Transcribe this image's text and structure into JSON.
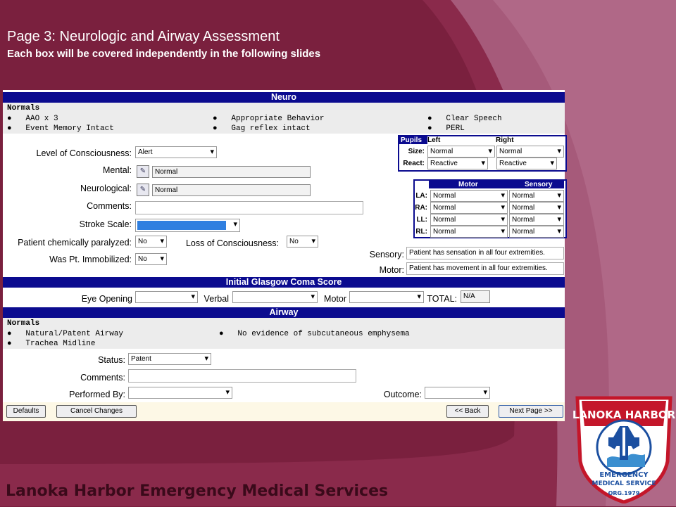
{
  "slide": {
    "title": "Page 3: Neurologic and Airway Assessment",
    "subtitle": "Each box will be covered independently in the following slides",
    "footer": "Lanoka Harbor Emergency Medical Services"
  },
  "colors": {
    "band": "#0b0b8f",
    "bg": "#7a1f3d",
    "highlight": "#2f7fe0"
  },
  "neuro": {
    "title": "Neuro",
    "normals_label": "Normals",
    "normals": [
      "AAO x 3",
      "Appropriate Behavior",
      "Clear Speech",
      "Event Memory Intact",
      "Gag reflex intact",
      "PERL"
    ],
    "loc_label": "Level of Consciousness:",
    "loc_value": "Alert",
    "mental_label": "Mental:",
    "mental_value": "Normal",
    "neuro_label": "Neurological:",
    "neuro_value": "Normal",
    "comments_label": "Comments:",
    "stroke_label": "Stroke Scale:",
    "paralyzed_label": "Patient chemically paralyzed:",
    "paralyzed_value": "No",
    "loss_label": "Loss of Consciousness:",
    "loss_value": "No",
    "immob_label": "Was Pt. Immobilized:",
    "immob_value": "No",
    "sensory_label": "Sensory:",
    "sensory_value": "Patient has sensation in all four extremities.",
    "motor_label": "Motor:",
    "motor_value": "Patient has movement in all four extremities.",
    "pupils": {
      "header": "Pupils",
      "left": "Left",
      "right": "Right",
      "size_label": "Size:",
      "react_label": "React:",
      "size_left": "Normal",
      "size_right": "Normal",
      "react_left": "Reactive",
      "react_right": "Reactive"
    },
    "limbs": {
      "motor": "Motor",
      "sensory": "Sensory",
      "rows": [
        {
          "label": "LA:",
          "motor": "Normal",
          "sensory": "Normal"
        },
        {
          "label": "RA:",
          "motor": "Normal",
          "sensory": "Normal"
        },
        {
          "label": "LL:",
          "motor": "Normal",
          "sensory": "Normal"
        },
        {
          "label": "RL:",
          "motor": "Normal",
          "sensory": "Normal"
        }
      ]
    }
  },
  "gcs": {
    "title": "Initial Glasgow Coma Score",
    "eye_label": "Eye Opening",
    "verbal_label": "Verbal",
    "motor_label": "Motor",
    "total_label": "TOTAL:",
    "total_value": "N/A"
  },
  "airway": {
    "title": "Airway",
    "normals_label": "Normals",
    "normals": [
      "Natural/Patent Airway",
      "No evidence of subcutaneous emphysema",
      "Trachea Midline"
    ],
    "status_label": "Status:",
    "status_value": "Patent",
    "comments_label": "Comments:",
    "performed_label": "Performed By:",
    "outcome_label": "Outcome:"
  },
  "buttons": {
    "defaults": "Defaults",
    "cancel": "Cancel Changes",
    "back": "<< Back",
    "next": "Next Page >>"
  },
  "logo": {
    "top": "LANOKA HARBOR",
    "line1": "EMERGENCY",
    "line2": "MEDICAL SERVICE",
    "org": "ORG.1979"
  }
}
